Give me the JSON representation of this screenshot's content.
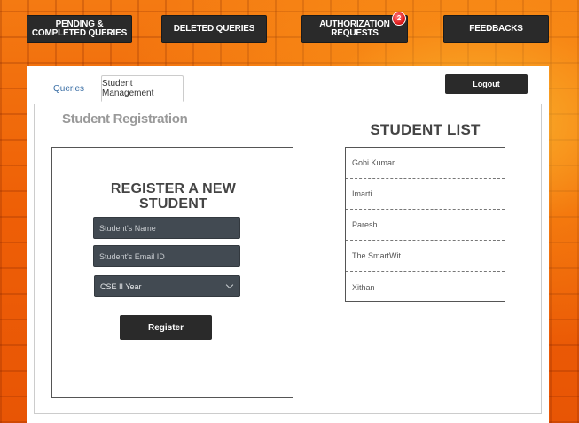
{
  "nav": {
    "pending_label": "PENDING & COMPLETED QUERIES",
    "deleted_label": "DELETED QUERIES",
    "authorization_label": "AUTHORIZATION REQUESTS",
    "authorization_badge": "2",
    "feedbacks_label": "FEEDBACKS"
  },
  "tabs": {
    "queries": "Queries",
    "student_management": "Student Management"
  },
  "logout_label": "Logout",
  "registration": {
    "section_title": "Student Registration",
    "heading": "REGISTER A NEW STUDENT",
    "name_placeholder": "Student's Name",
    "email_placeholder": "Student's Email ID",
    "year_selected": "CSE II Year",
    "register_label": "Register"
  },
  "student_list": {
    "title": "STUDENT LIST",
    "students": [
      "Gobi Kumar",
      "Imarti",
      "Paresh",
      "The SmartWit",
      "Xithan"
    ]
  },
  "colors": {
    "background": "#f26a0a",
    "button_dark": "#2a2a2a",
    "field_bg": "#424a52",
    "badge": "#e02020",
    "tab_link": "#3a6ea5"
  }
}
